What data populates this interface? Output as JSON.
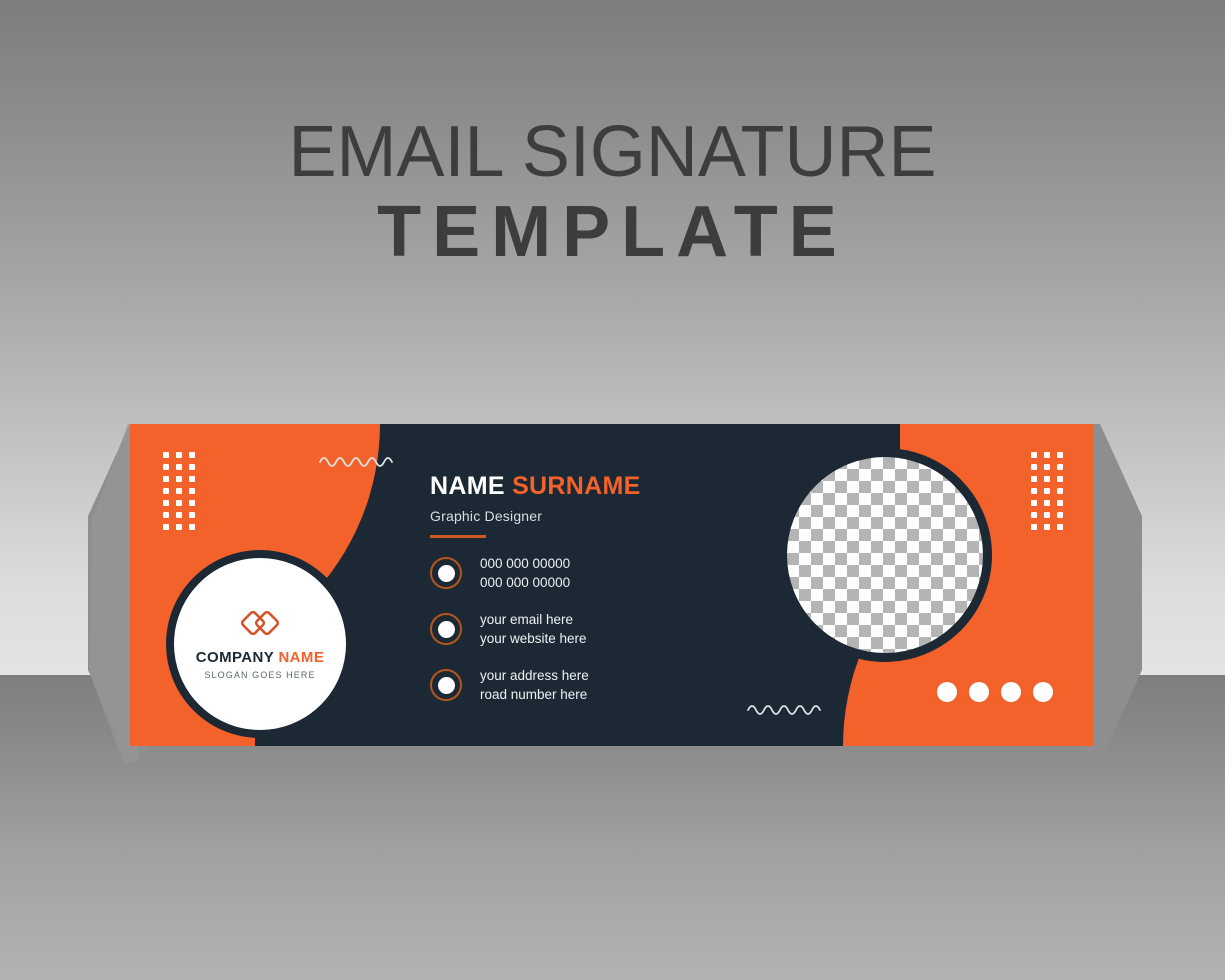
{
  "heading": {
    "line1": "EMAIL SIGNATURE",
    "line2": "TEMPLATE"
  },
  "colors": {
    "orange": "#f2622a",
    "orange_dark": "#cc5a22",
    "navy": "#1c2833",
    "white": "#ffffff",
    "heading_gray": "#3d3d3d",
    "slogan_gray": "#5b6670"
  },
  "card": {
    "logo": {
      "mark": "diamonds-logo-icon",
      "company": "COMPANY",
      "company_accent": "NAME",
      "slogan": "SLOGAN GOES HERE"
    },
    "person": {
      "first_name": "NAME",
      "last_name": "SURNAME",
      "role": "Graphic Designer"
    },
    "contacts": [
      {
        "icon": "phone-icon",
        "line1": "000 000 00000",
        "line2": "000 000 00000"
      },
      {
        "icon": "email-icon",
        "line1": "your email here",
        "line2": "your website here"
      },
      {
        "icon": "location-icon",
        "line1": "your address here",
        "line2": "road number here"
      }
    ],
    "photo": {
      "placeholder": "photo-placeholder-checkerboard"
    },
    "decorations": {
      "dot_grid_columns": 3,
      "dot_grid_rows": 7,
      "white_dot_count": 4,
      "squiggle_count": 2
    }
  }
}
